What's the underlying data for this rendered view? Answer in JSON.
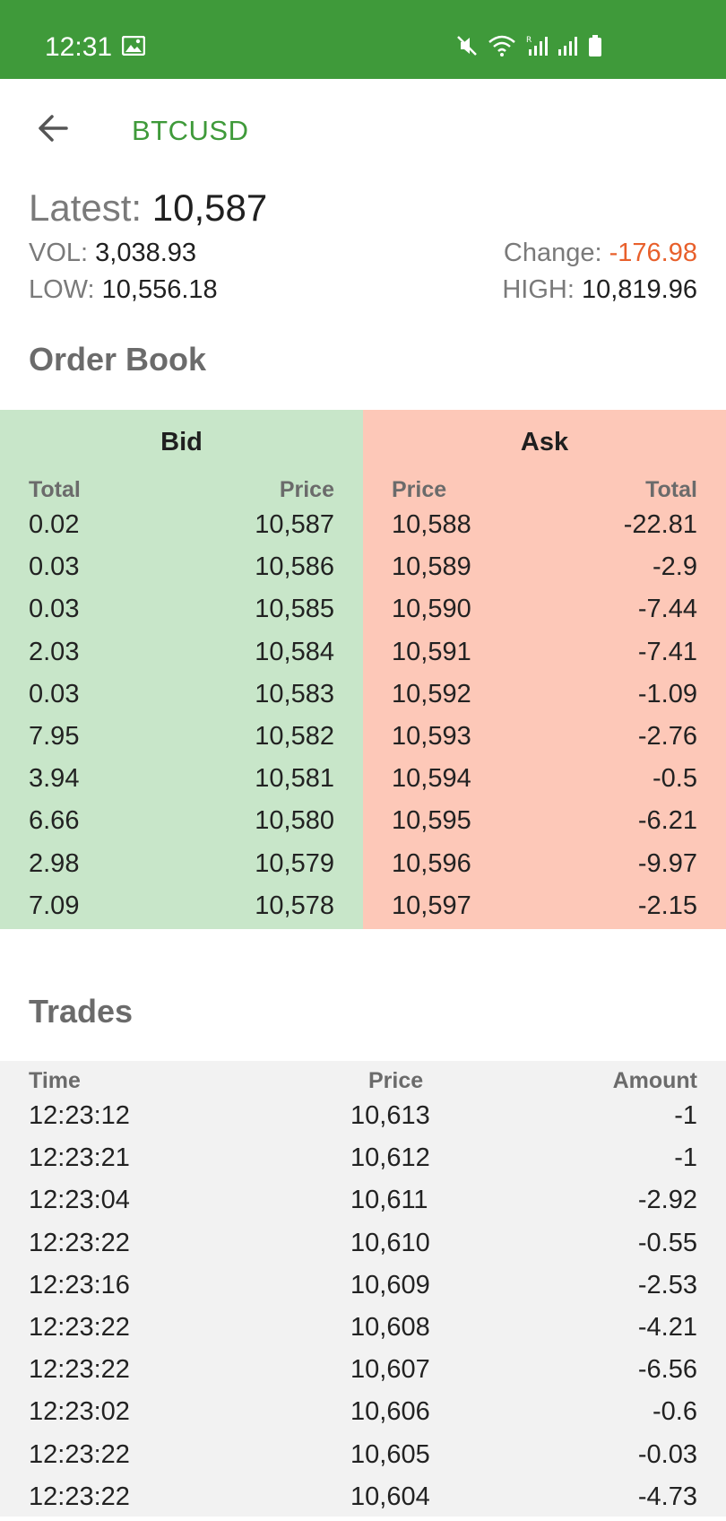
{
  "status_bar": {
    "time": "12:31",
    "icons_left": [
      "image-icon"
    ],
    "icons_right": [
      "mute-icon",
      "wifi-icon",
      "signal-r-icon",
      "signal-icon",
      "battery-icon"
    ]
  },
  "toolbar": {
    "title": "BTCUSD",
    "back_icon": "arrow-left-icon"
  },
  "summary": {
    "latest_label": "Latest:",
    "latest_value": "10,587",
    "vol_label": "VOL:",
    "vol_value": "3,038.93",
    "low_label": "LOW:",
    "low_value": "10,556.18",
    "change_label": "Change:",
    "change_value": "-176.98",
    "high_label": "HIGH:",
    "high_value": "10,819.96"
  },
  "order_book": {
    "title": "Order Book",
    "bid": {
      "header": "Bid",
      "col_total": "Total",
      "col_price": "Price",
      "rows": [
        {
          "total": "0.02",
          "price": "10,587"
        },
        {
          "total": "0.03",
          "price": "10,586"
        },
        {
          "total": "0.03",
          "price": "10,585"
        },
        {
          "total": "2.03",
          "price": "10,584"
        },
        {
          "total": "0.03",
          "price": "10,583"
        },
        {
          "total": "7.95",
          "price": "10,582"
        },
        {
          "total": "3.94",
          "price": "10,581"
        },
        {
          "total": "6.66",
          "price": "10,580"
        },
        {
          "total": "2.98",
          "price": "10,579"
        },
        {
          "total": "7.09",
          "price": "10,578"
        }
      ]
    },
    "ask": {
      "header": "Ask",
      "col_price": "Price",
      "col_total": "Total",
      "rows": [
        {
          "price": "10,588",
          "total": "-22.81"
        },
        {
          "price": "10,589",
          "total": "-2.9"
        },
        {
          "price": "10,590",
          "total": "-7.44"
        },
        {
          "price": "10,591",
          "total": "-7.41"
        },
        {
          "price": "10,592",
          "total": "-1.09"
        },
        {
          "price": "10,593",
          "total": "-2.76"
        },
        {
          "price": "10,594",
          "total": "-0.5"
        },
        {
          "price": "10,595",
          "total": "-6.21"
        },
        {
          "price": "10,596",
          "total": "-9.97"
        },
        {
          "price": "10,597",
          "total": "-2.15"
        }
      ]
    }
  },
  "trades": {
    "title": "Trades",
    "col_time": "Time",
    "col_price": "Price",
    "col_amount": "Amount",
    "rows": [
      {
        "time": "12:23:12",
        "price": "10,613",
        "amount": "-1"
      },
      {
        "time": "12:23:21",
        "price": "10,612",
        "amount": "-1"
      },
      {
        "time": "12:23:04",
        "price": "10,611",
        "amount": "-2.92"
      },
      {
        "time": "12:23:22",
        "price": "10,610",
        "amount": "-0.55"
      },
      {
        "time": "12:23:16",
        "price": "10,609",
        "amount": "-2.53"
      },
      {
        "time": "12:23:22",
        "price": "10,608",
        "amount": "-4.21"
      },
      {
        "time": "12:23:22",
        "price": "10,607",
        "amount": "-6.56"
      },
      {
        "time": "12:23:02",
        "price": "10,606",
        "amount": "-0.6"
      },
      {
        "time": "12:23:22",
        "price": "10,605",
        "amount": "-0.03"
      },
      {
        "time": "12:23:22",
        "price": "10,604",
        "amount": "-4.73"
      }
    ]
  },
  "colors": {
    "brand_green": "#3f9a3a",
    "bid_bg": "#c8e6c9",
    "ask_bg": "#fdc8b8",
    "change_negative": "#e8602c",
    "trades_bg": "#f2f2f2"
  }
}
